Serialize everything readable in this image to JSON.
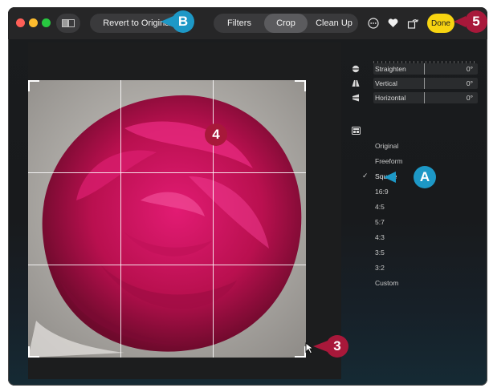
{
  "toolbar": {
    "revert_label": "Revert to Original",
    "tabs": [
      "Filters",
      "Crop",
      "Clean Up"
    ],
    "active_tab": "Crop",
    "done_label": "Done"
  },
  "adjustments": {
    "sliders": [
      {
        "label": "Straighten",
        "value": "0°"
      },
      {
        "label": "Vertical",
        "value": "0°"
      },
      {
        "label": "Horizontal",
        "value": "0°"
      }
    ]
  },
  "aspect_ratios": {
    "items": [
      "Original",
      "Freeform",
      "Square",
      "16:9",
      "4:5",
      "5:7",
      "4:3",
      "3:5",
      "3:2",
      "Custom"
    ],
    "selected": "Square",
    "checkmark": "✓"
  },
  "callouts": {
    "a": "A",
    "b": "B",
    "three": "3",
    "four": "4",
    "five": "5"
  },
  "colors": {
    "callout_blue": "#1d98c6",
    "callout_red": "#a8183a",
    "done_yellow": "#f7d411",
    "rose": "#c4145a"
  }
}
